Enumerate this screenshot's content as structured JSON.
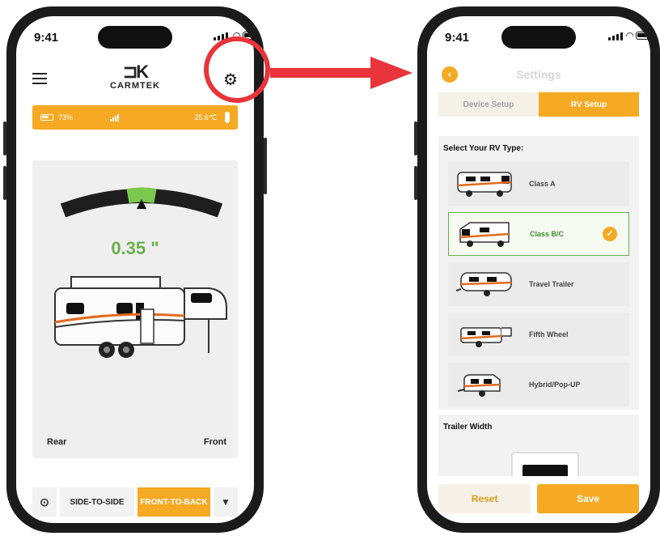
{
  "left_phone": {
    "status_time": "9:41",
    "app_logo": "CARMTEK",
    "status_strip": {
      "battery": "73%",
      "temperature": "25.6℃"
    },
    "reading": "0.35 \"",
    "labels": {
      "rear": "Rear",
      "front": "Front"
    },
    "bottom_nav": {
      "side_to_side": "SIDE-TO-SIDE",
      "front_to_back": "FRONT-TO-BACK"
    },
    "icons": {
      "menu": "menu-icon",
      "settings": "gear-icon",
      "target": "crosshair-icon",
      "light": "flashlight-icon"
    }
  },
  "right_phone": {
    "status_time": "9:41",
    "title": "Settings",
    "tabs": [
      {
        "label": "Device Setup",
        "active": false
      },
      {
        "label": "RV Setup",
        "active": true
      }
    ],
    "rv_section_heading": "Select Your RV Type:",
    "rv_types": [
      {
        "label": "Class A",
        "selected": false
      },
      {
        "label": "Class B/C",
        "selected": true
      },
      {
        "label": "Travel Trailer",
        "selected": false
      },
      {
        "label": "Fifth Wheel",
        "selected": false
      },
      {
        "label": "Hybrid/Pop-UP",
        "selected": false
      }
    ],
    "trailer_width_heading": "Trailer Width",
    "buttons": {
      "reset": "Reset",
      "save": "Save"
    }
  },
  "colors": {
    "accent": "#f6a923",
    "green": "#6ab04c",
    "highlight_red": "#e8343a"
  }
}
